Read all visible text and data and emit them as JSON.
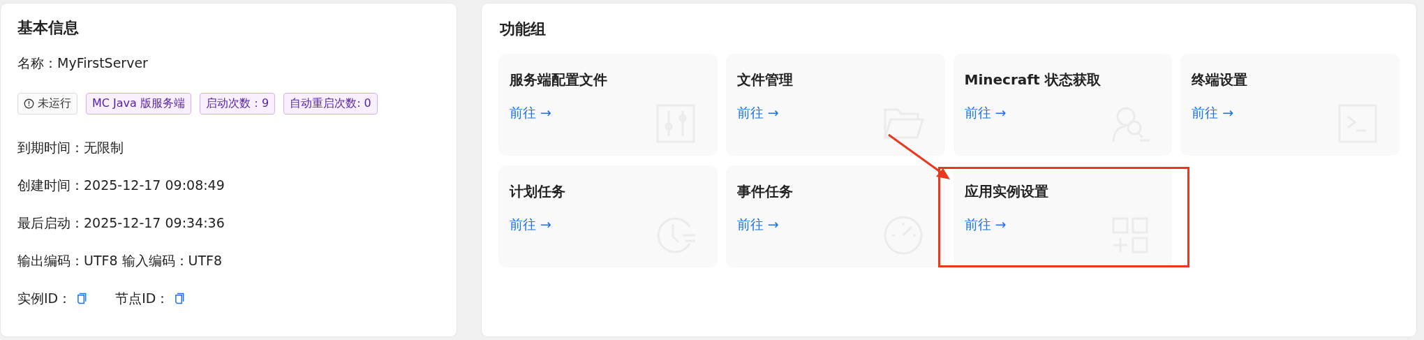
{
  "basic_info": {
    "title": "基本信息",
    "name_line": "名称：MyFirstServer",
    "tags": [
      {
        "kind": "status",
        "label": "未运行"
      },
      {
        "kind": "info",
        "label": "MC Java 版服务端"
      },
      {
        "kind": "info",
        "label": "启动次数：9"
      },
      {
        "kind": "info",
        "label": "自动重启次数: 0"
      }
    ],
    "lines": [
      "到期时间：无限制",
      "创建时间：2025-12-17 09:08:49",
      "最后启动：2025-12-17 09:34:36",
      "输出编码：UTF8  输入编码：UTF8"
    ],
    "ids": [
      {
        "label": "实例ID："
      },
      {
        "label": "节点ID："
      }
    ]
  },
  "feature_group": {
    "title": "功能组",
    "cards": [
      {
        "title": "服务端配置文件",
        "link": "前往 →",
        "kind": "sliders",
        "highlighted": false
      },
      {
        "title": "文件管理",
        "link": "前往 →",
        "kind": "folder",
        "highlighted": false
      },
      {
        "title": "Minecraft 状态获取",
        "link": "前往 →",
        "kind": "search",
        "highlighted": false
      },
      {
        "title": "终端设置",
        "link": "前往 →",
        "kind": "terminal",
        "highlighted": false
      },
      {
        "title": "计划任务",
        "link": "前往 →",
        "kind": "clock",
        "highlighted": false
      },
      {
        "title": "事件任务",
        "link": "前往 →",
        "kind": "gauge",
        "highlighted": false
      },
      {
        "title": "应用实例设置",
        "link": "前往 →",
        "kind": "grid",
        "highlighted": true
      }
    ]
  }
}
